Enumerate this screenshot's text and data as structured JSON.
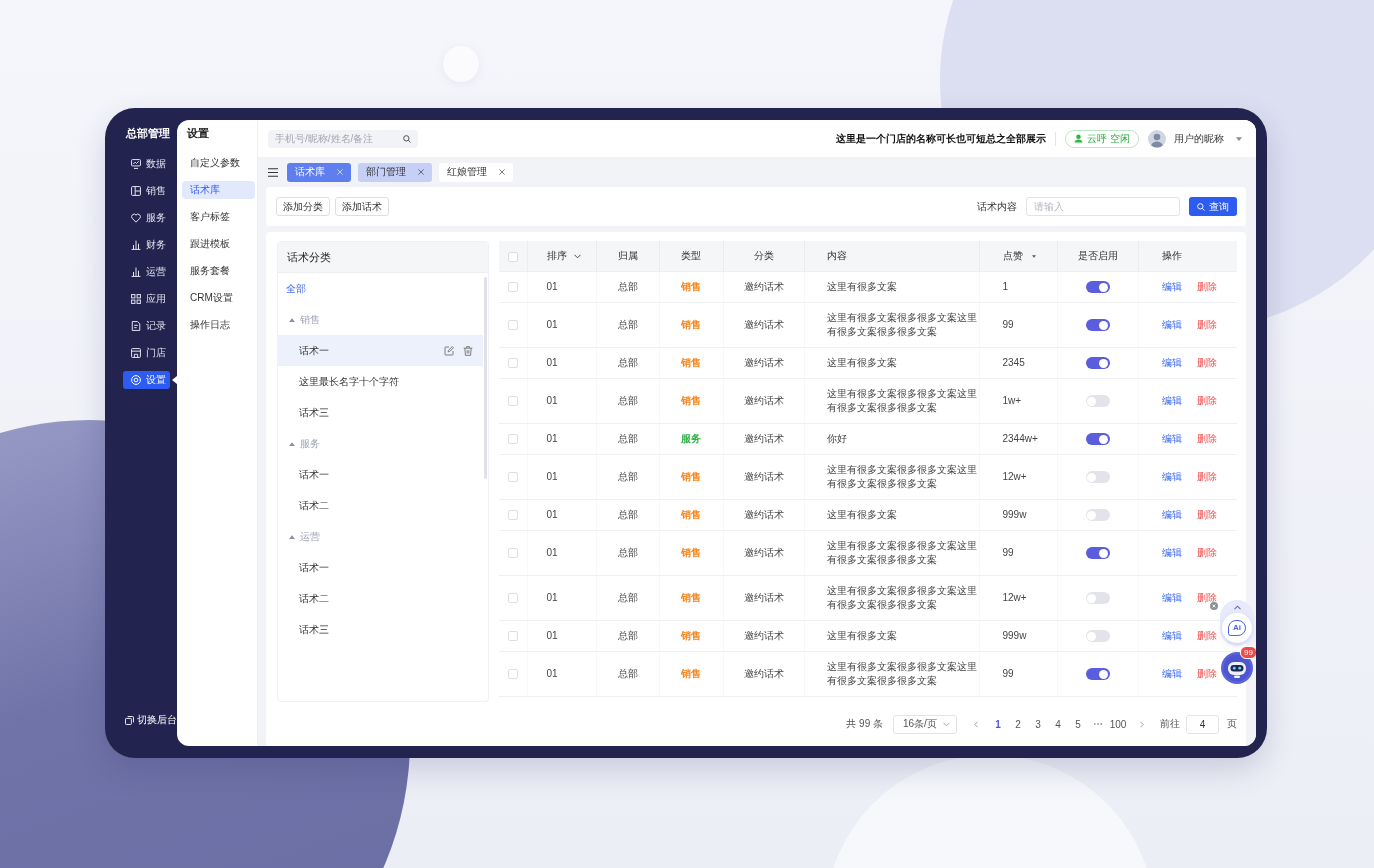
{
  "nav": {
    "title": "总部管理",
    "items": [
      {
        "label": "数据",
        "selected": false
      },
      {
        "label": "销售",
        "selected": false
      },
      {
        "label": "服务",
        "selected": false
      },
      {
        "label": "财务",
        "selected": false
      },
      {
        "label": "运营",
        "selected": false
      },
      {
        "label": "应用",
        "selected": false
      },
      {
        "label": "记录",
        "selected": false
      },
      {
        "label": "门店",
        "selected": false
      },
      {
        "label": "设置",
        "selected": true
      }
    ],
    "footer": "切换后台"
  },
  "submenu": {
    "title": "设置",
    "items": [
      {
        "label": "自定义参数",
        "selected": false
      },
      {
        "label": "话术库",
        "selected": true
      },
      {
        "label": "客户标签",
        "selected": false
      },
      {
        "label": "跟进模板",
        "selected": false
      },
      {
        "label": "服务套餐",
        "selected": false
      },
      {
        "label": "CRM设置",
        "selected": false
      },
      {
        "label": "操作日志",
        "selected": false
      }
    ]
  },
  "header": {
    "search": {
      "placeholder": "手机号/昵称/姓名/备注"
    },
    "store_name": "这里是一个门店的名称可长也可短总之全部展示",
    "call_status": "云呼 空闲",
    "user_name": "用户的昵称"
  },
  "tabs": [
    {
      "label": "话术库",
      "selected": true,
      "hovered": false
    },
    {
      "label": "部门管理",
      "selected": false,
      "hovered": true
    },
    {
      "label": "红娘管理",
      "selected": false,
      "hovered": false
    }
  ],
  "toolbar": {
    "buttons": [
      "添加分类",
      "添加话术"
    ],
    "filter": {
      "label": "话术内容",
      "placeholder": "请输入"
    },
    "query_button": "查询"
  },
  "categories": {
    "title": "话术分类",
    "all": "全部",
    "groups": [
      {
        "label": "销售",
        "expanded": true,
        "children": [
          {
            "label": "话术一",
            "selected": true
          },
          {
            "label": "这里最长名字十个字符",
            "selected": false
          },
          {
            "label": "话术三",
            "selected": false
          }
        ]
      },
      {
        "label": "服务",
        "expanded": true,
        "children": [
          {
            "label": "话术一",
            "selected": false
          },
          {
            "label": "话术二",
            "selected": false
          }
        ]
      },
      {
        "label": "运营",
        "expanded": true,
        "children": [
          {
            "label": "话术一",
            "selected": false
          },
          {
            "label": "话术二",
            "selected": false
          },
          {
            "label": "话术三",
            "selected": false
          }
        ]
      }
    ]
  },
  "table": {
    "header_checked": false,
    "columns": [
      {
        "label": "排序",
        "kind": "dropdown"
      },
      {
        "label": "归属",
        "kind": "plain"
      },
      {
        "label": "类型",
        "kind": "plain"
      },
      {
        "label": "分类",
        "kind": "plain"
      },
      {
        "label": "内容",
        "kind": "plain"
      },
      {
        "label": "点赞",
        "kind": "sort"
      },
      {
        "label": "是否启用",
        "kind": "plain"
      },
      {
        "label": "操作",
        "kind": "plain"
      }
    ],
    "rows": [
      {
        "checked": false,
        "order": "01",
        "owner": "总部",
        "type": {
          "label": "销售",
          "color": "#f7861c"
        },
        "category": "邀约话术",
        "content": "这里有很多文案",
        "likes": "1",
        "enabled": true,
        "actions": [
          {
            "label": "编辑",
            "kind": "edit"
          },
          {
            "label": "删除",
            "kind": "delete"
          }
        ]
      },
      {
        "checked": false,
        "order": "01",
        "owner": "总部",
        "type": {
          "label": "销售",
          "color": "#f7861c"
        },
        "category": "邀约话术",
        "content": "这里有很多文案很多很多文案这里有很多文案很多很多文案",
        "likes": "99",
        "enabled": true,
        "actions": [
          {
            "label": "编辑",
            "kind": "edit"
          },
          {
            "label": "删除",
            "kind": "delete"
          }
        ]
      },
      {
        "checked": false,
        "order": "01",
        "owner": "总部",
        "type": {
          "label": "销售",
          "color": "#f7861c"
        },
        "category": "邀约话术",
        "content": "这里有很多文案",
        "likes": "2345",
        "enabled": true,
        "actions": [
          {
            "label": "编辑",
            "kind": "edit"
          },
          {
            "label": "删除",
            "kind": "delete"
          }
        ]
      },
      {
        "checked": false,
        "order": "01",
        "owner": "总部",
        "type": {
          "label": "销售",
          "color": "#f7861c"
        },
        "category": "邀约话术",
        "content": "这里有很多文案很多很多文案这里有很多文案很多很多文案",
        "likes": "1w+",
        "enabled": false,
        "actions": [
          {
            "label": "编辑",
            "kind": "edit"
          },
          {
            "label": "删除",
            "kind": "delete"
          }
        ]
      },
      {
        "checked": false,
        "order": "01",
        "owner": "总部",
        "type": {
          "label": "服务",
          "color": "#2fb344"
        },
        "category": "邀约话术",
        "content": "你好",
        "likes": "2344w+",
        "enabled": true,
        "actions": [
          {
            "label": "编辑",
            "kind": "edit"
          },
          {
            "label": "删除",
            "kind": "delete"
          }
        ]
      },
      {
        "checked": false,
        "order": "01",
        "owner": "总部",
        "type": {
          "label": "销售",
          "color": "#f7861c"
        },
        "category": "邀约话术",
        "content": "这里有很多文案很多很多文案这里有很多文案很多很多文案",
        "likes": "12w+",
        "enabled": false,
        "actions": [
          {
            "label": "编辑",
            "kind": "edit"
          },
          {
            "label": "删除",
            "kind": "delete"
          }
        ]
      },
      {
        "checked": false,
        "order": "01",
        "owner": "总部",
        "type": {
          "label": "销售",
          "color": "#f7861c"
        },
        "category": "邀约话术",
        "content": "这里有很多文案",
        "likes": "999w",
        "enabled": false,
        "actions": [
          {
            "label": "编辑",
            "kind": "edit"
          },
          {
            "label": "删除",
            "kind": "delete"
          }
        ]
      },
      {
        "checked": false,
        "order": "01",
        "owner": "总部",
        "type": {
          "label": "销售",
          "color": "#f7861c"
        },
        "category": "邀约话术",
        "content": "这里有很多文案很多很多文案这里有很多文案很多很多文案",
        "likes": "99",
        "enabled": true,
        "actions": [
          {
            "label": "编辑",
            "kind": "edit"
          },
          {
            "label": "删除",
            "kind": "delete"
          }
        ]
      },
      {
        "checked": false,
        "order": "01",
        "owner": "总部",
        "type": {
          "label": "销售",
          "color": "#f7861c"
        },
        "category": "邀约话术",
        "content": "这里有很多文案很多很多文案这里有很多文案很多很多文案",
        "likes": "12w+",
        "enabled": false,
        "actions": [
          {
            "label": "编辑",
            "kind": "edit"
          },
          {
            "label": "删除",
            "kind": "delete"
          }
        ]
      },
      {
        "checked": false,
        "order": "01",
        "owner": "总部",
        "type": {
          "label": "销售",
          "color": "#f7861c"
        },
        "category": "邀约话术",
        "content": "这里有很多文案",
        "likes": "999w",
        "enabled": false,
        "actions": [
          {
            "label": "编辑",
            "kind": "edit"
          },
          {
            "label": "删除",
            "kind": "delete"
          }
        ]
      },
      {
        "checked": false,
        "order": "01",
        "owner": "总部",
        "type": {
          "label": "销售",
          "color": "#f7861c"
        },
        "category": "邀约话术",
        "content": "这里有很多文案很多很多文案这里有很多文案很多很多文案",
        "likes": "99",
        "enabled": true,
        "actions": [
          {
            "label": "编辑",
            "kind": "edit"
          },
          {
            "label": "删除",
            "kind": "delete"
          }
        ]
      }
    ]
  },
  "pagination": {
    "total": "共 99 条",
    "page_size": "16条/页",
    "pages": [
      {
        "kind": "page",
        "label": "1",
        "selected": true
      },
      {
        "kind": "page",
        "label": "2",
        "selected": false
      },
      {
        "kind": "page",
        "label": "3",
        "selected": false
      },
      {
        "kind": "page",
        "label": "4",
        "selected": false
      },
      {
        "kind": "page",
        "label": "5",
        "selected": false
      },
      {
        "kind": "ellipsis"
      },
      {
        "kind": "page",
        "label": "100",
        "selected": false
      }
    ],
    "goto_label": "前往",
    "goto_value": "4",
    "unit": "页"
  },
  "assistant": {
    "ai_label": "Ai",
    "badge": "99"
  }
}
